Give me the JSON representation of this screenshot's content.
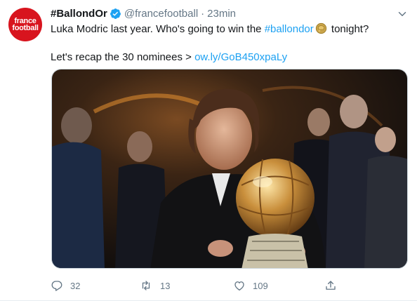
{
  "tweet": {
    "avatar_line1": "france",
    "avatar_line2": "football",
    "name": "#BallondOr",
    "handle": "@francefootball",
    "separator": "·",
    "time": "23min",
    "text_before": "Luka Modric last year. Who's going to win the ",
    "hashtag": "#ballondor",
    "text_after": " tonight?",
    "recap_text": "Let's recap the 30 nominees > ",
    "link": "ow.ly/GoB450xpaLy",
    "reply_count": "32",
    "retweet_count": "13",
    "like_count": "109"
  },
  "colors": {
    "accent": "#1da1f2",
    "secondary_text": "#657786",
    "brand": "#d8141e"
  },
  "icons": [
    "verified-badge-icon",
    "chevron-down-icon",
    "ballon-dor-emoji-icon",
    "reply-icon",
    "retweet-icon",
    "like-icon",
    "share-icon"
  ]
}
